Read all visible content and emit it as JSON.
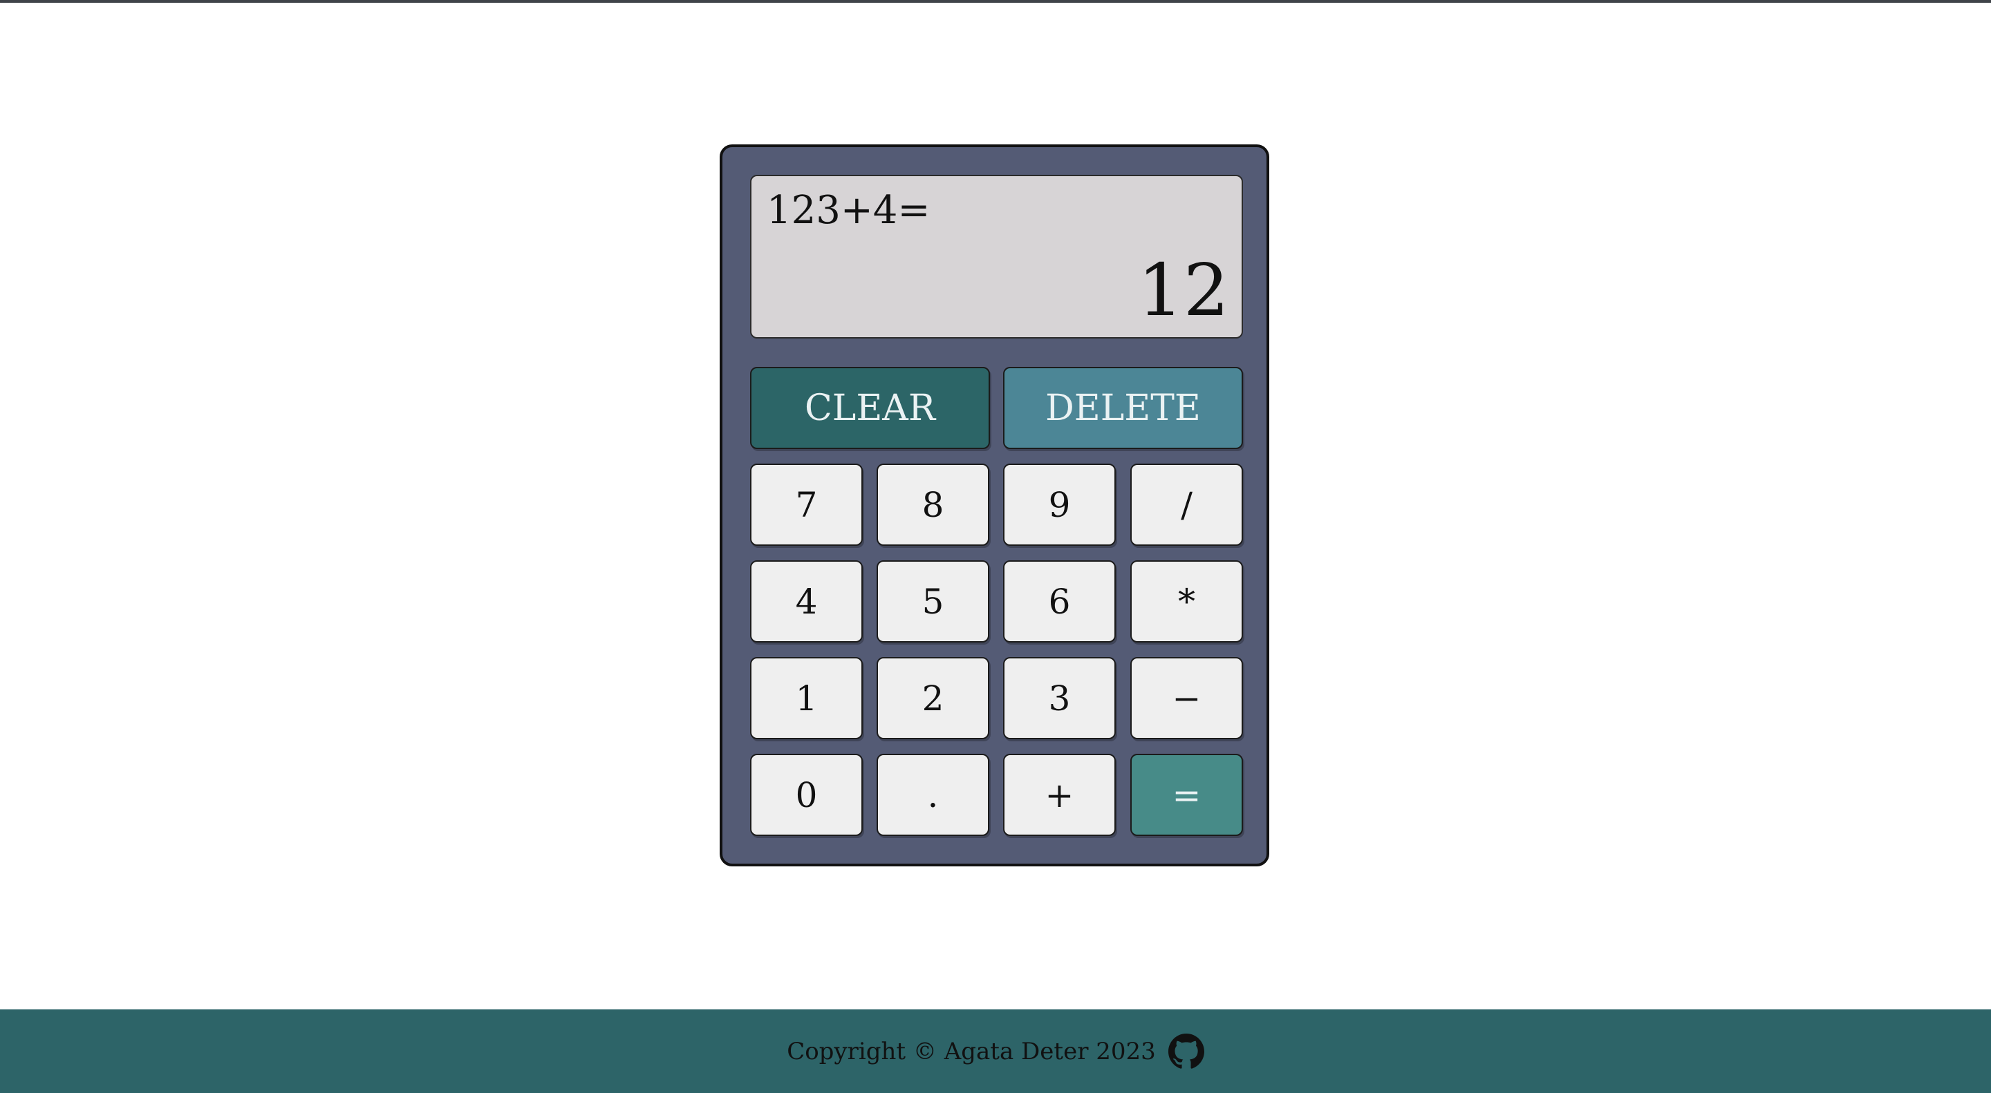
{
  "display": {
    "previous": "123+4=",
    "current": "12"
  },
  "controls": {
    "clear": "CLEAR",
    "delete": "DELETE"
  },
  "keys": {
    "row1": [
      "7",
      "8",
      "9",
      "/"
    ],
    "row2": [
      "4",
      "5",
      "6",
      "*"
    ],
    "row3": [
      "1",
      "2",
      "3",
      "−"
    ],
    "row4": [
      "0",
      ".",
      "+",
      "="
    ]
  },
  "footer": {
    "copyright": "Copyright © Agata Deter 2023",
    "github_icon": "github-icon"
  },
  "colors": {
    "calculator_body": "#545b75",
    "display_bg": "#d7d4d6",
    "clear_button": "#2c6567",
    "delete_button": "#4c8696",
    "equals_button": "#478b88",
    "footer_bg": "#2d6468"
  }
}
